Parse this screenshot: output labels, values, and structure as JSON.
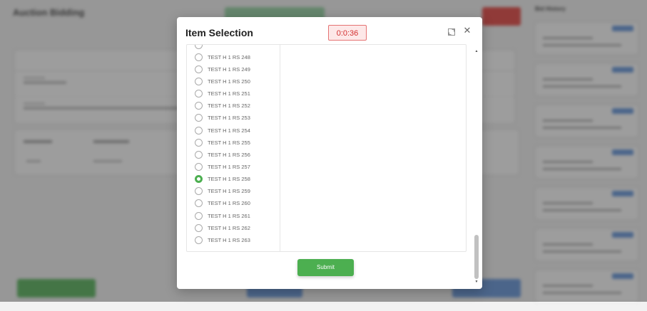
{
  "modal": {
    "title": "Item Selection",
    "timer": "0:0:36",
    "submit_label": "Submit",
    "selected_item": "TEST H 1 RS 258",
    "items": [
      {
        "label": "",
        "checked": false
      },
      {
        "label": "TEST H 1 RS 248",
        "checked": false
      },
      {
        "label": "TEST H 1 RS 249",
        "checked": false
      },
      {
        "label": "TEST H 1 RS 250",
        "checked": false
      },
      {
        "label": "TEST H 1 RS 251",
        "checked": false
      },
      {
        "label": "TEST H 1 RS 252",
        "checked": false
      },
      {
        "label": "TEST H 1 RS 253",
        "checked": false
      },
      {
        "label": "TEST H 1 RS 254",
        "checked": false
      },
      {
        "label": "TEST H 1 RS 255",
        "checked": false
      },
      {
        "label": "TEST H 1 RS 256",
        "checked": false
      },
      {
        "label": "TEST H 1 RS 257",
        "checked": false
      },
      {
        "label": "TEST H 1 RS 258",
        "checked": true
      },
      {
        "label": "TEST H 1 RS 259",
        "checked": false
      },
      {
        "label": "TEST H 1 RS 260",
        "checked": false
      },
      {
        "label": "TEST H 1 RS 261",
        "checked": false
      },
      {
        "label": "TEST H 1 RS 262",
        "checked": false
      },
      {
        "label": "TEST H 1 RS 263",
        "checked": false
      }
    ]
  },
  "icons": {
    "expand": "expand-icon",
    "close": "close-icon"
  },
  "colors": {
    "accent_green": "#4caf50",
    "timer_red": "#d32f2f",
    "timer_bg": "#fde8e8",
    "primary_blue": "#5b8fd9",
    "danger_red": "#e53935"
  },
  "background": {
    "header_title": "Auction Bidding",
    "history_title": "Bid History"
  }
}
